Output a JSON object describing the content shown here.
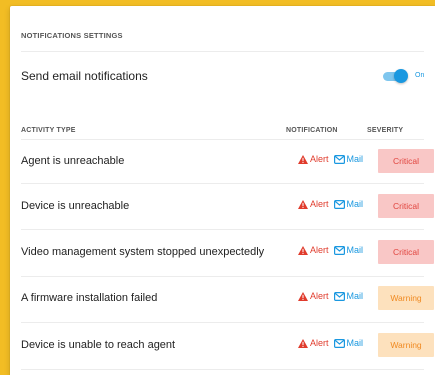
{
  "panel": {
    "title": "NOTIFICATIONS SETTINGS",
    "email_label": "Send email notifications",
    "toggle_state": "On"
  },
  "table": {
    "columns": [
      "ACTIVITY TYPE",
      "NOTIFICATION",
      "SEVERITY"
    ],
    "rows": [
      {
        "activity": "Agent is unreachable",
        "alert_label": "Alert",
        "mail_label": "Mail",
        "severity": "Critical"
      },
      {
        "activity": "Device is unreachable",
        "alert_label": "Alert",
        "mail_label": "Mail",
        "severity": "Critical"
      },
      {
        "activity": "Video management system stopped unexpectedly",
        "alert_label": "Alert",
        "mail_label": "Mail",
        "severity": "Critical"
      },
      {
        "activity": "A firmware installation failed",
        "alert_label": "Alert",
        "mail_label": "Mail",
        "severity": "Warning"
      },
      {
        "activity": "Device is unable to reach agent",
        "alert_label": "Alert",
        "mail_label": "Mail",
        "severity": "Warning"
      }
    ]
  },
  "colors": {
    "background": "#f2bd24",
    "accent": "#1a98e0",
    "alert": "#e03b2c",
    "critical_bg": "#f9c7c6",
    "critical_text": "#e1453f",
    "warning_bg": "#fde1bd",
    "warning_text": "#f08a22"
  },
  "icons": {
    "alert": "warning-triangle-icon",
    "mail": "envelope-icon"
  }
}
